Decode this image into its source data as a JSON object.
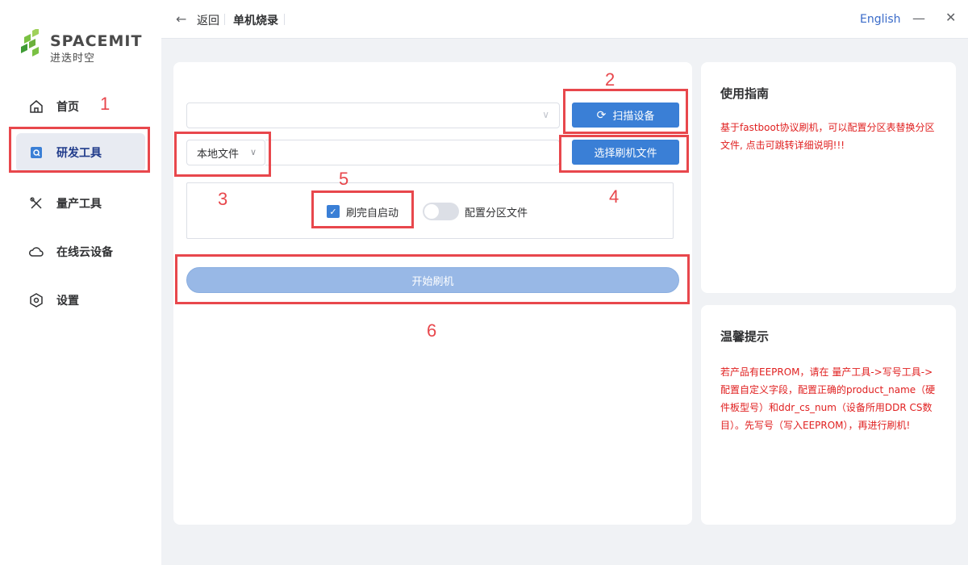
{
  "sidebar": {
    "logo": {
      "brand": "SPACEMIT",
      "subtitle": "进迭时空",
      "colors": [
        "#7ac143",
        "#3f9b35"
      ]
    },
    "items": [
      {
        "label": "首页",
        "icon": "home-icon",
        "active": false
      },
      {
        "label": "研发工具",
        "icon": "dev-tools-icon",
        "active": true
      },
      {
        "label": "量产工具",
        "icon": "production-tools-icon",
        "active": false
      },
      {
        "label": "在线云设备",
        "icon": "cloud-icon",
        "active": false
      },
      {
        "label": "设置",
        "icon": "settings-icon",
        "active": false
      }
    ]
  },
  "header": {
    "back_label": "返回",
    "title": "单机烧录",
    "language": "English",
    "minimize_icon": "minimize-icon",
    "close_icon": "close-icon"
  },
  "main": {
    "device_select": {
      "value": "",
      "placeholder": ""
    },
    "scan_button": "扫描设备",
    "source_select": "本地文件",
    "file_path": "",
    "choose_file_button": "选择刷机文件",
    "auto_reboot": {
      "label": "刷完自启动",
      "checked": true
    },
    "partition_toggle": {
      "label": "配置分区文件",
      "on": false
    },
    "start_button": "开始刷机"
  },
  "guide": {
    "title": "使用指南",
    "body": "基于fastboot协议刷机，可以配置分区表替换分区文件, 点击可跳转详细说明!!!"
  },
  "tips": {
    "title": "温馨提示",
    "body": "若产品有EEPROM，请在 量产工具->写号工具->配置自定义字段，配置正确的product_name（硬件板型号）和ddr_cs_num（设备所用DDR CS数目）。先写号（写入EEPROM），再进行刷机!"
  },
  "annotations": [
    "1",
    "2",
    "3",
    "4",
    "5",
    "6"
  ],
  "colors": {
    "accent": "#3a7fd6",
    "annotation": "#e8474c",
    "warning_text": "#e02020"
  }
}
